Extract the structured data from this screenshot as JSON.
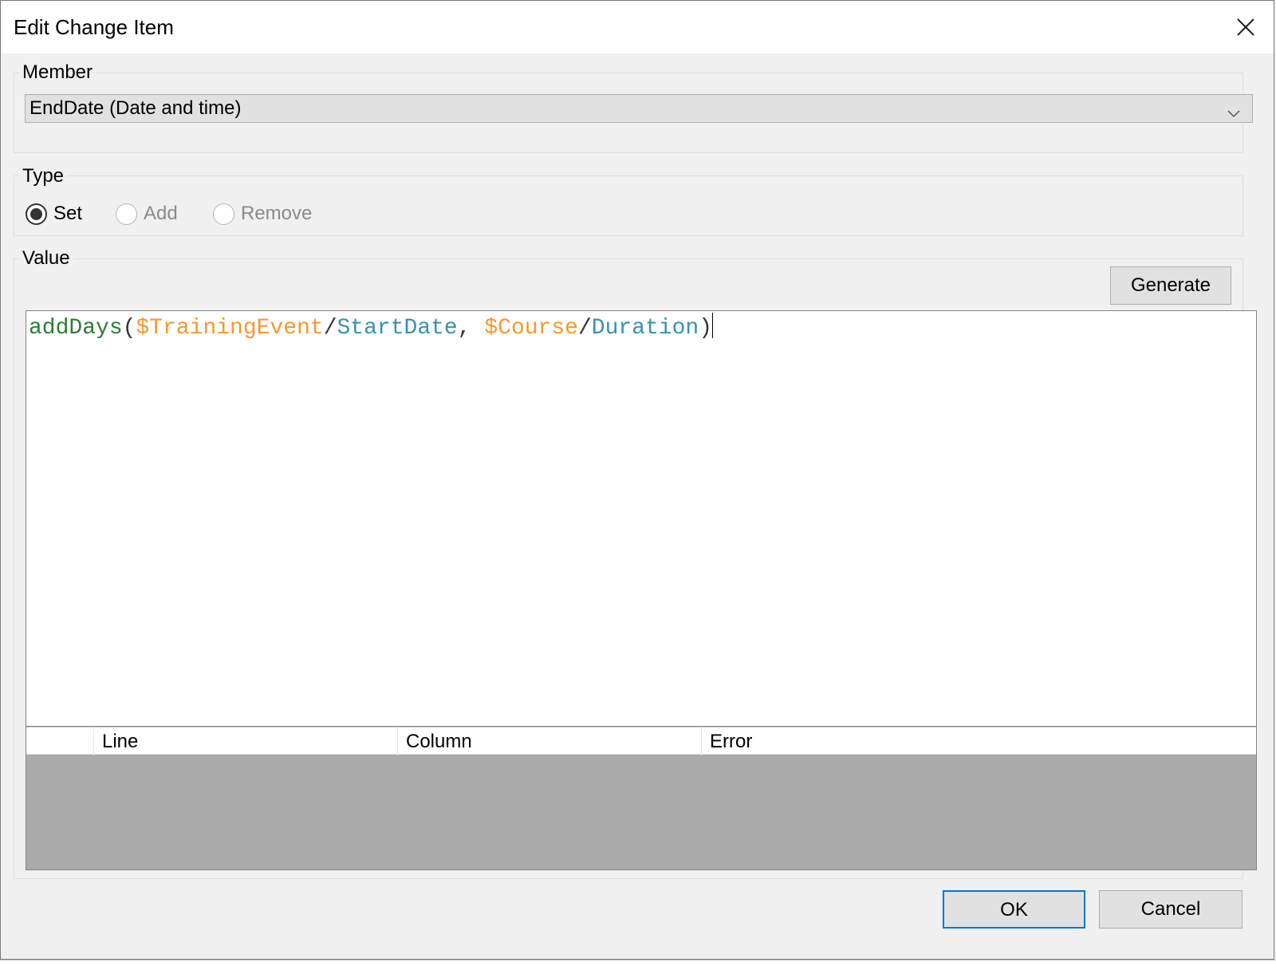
{
  "window": {
    "title": "Edit Change Item"
  },
  "member": {
    "group_label": "Member",
    "selected": "EndDate (Date and time)"
  },
  "type": {
    "group_label": "Type",
    "options": [
      {
        "label": "Set",
        "checked": true,
        "enabled": true
      },
      {
        "label": "Add",
        "checked": false,
        "enabled": false
      },
      {
        "label": "Remove",
        "checked": false,
        "enabled": false
      }
    ]
  },
  "value": {
    "group_label": "Value",
    "generate_label": "Generate",
    "expression": {
      "fn": "addDays",
      "open": "(",
      "var1": "$TrainingEvent",
      "sep1": "/",
      "attr1": "StartDate",
      "comma": ", ",
      "var2": "$Course",
      "sep2": "/",
      "attr2": "Duration",
      "close": ")"
    },
    "colors": {
      "function": "#2e7d32",
      "variable": "#f29a2e",
      "attribute": "#3b8fb3"
    }
  },
  "errors_table": {
    "columns": [
      "",
      "Line",
      "Column",
      "Error"
    ],
    "rows": []
  },
  "footer": {
    "ok_label": "OK",
    "cancel_label": "Cancel"
  }
}
